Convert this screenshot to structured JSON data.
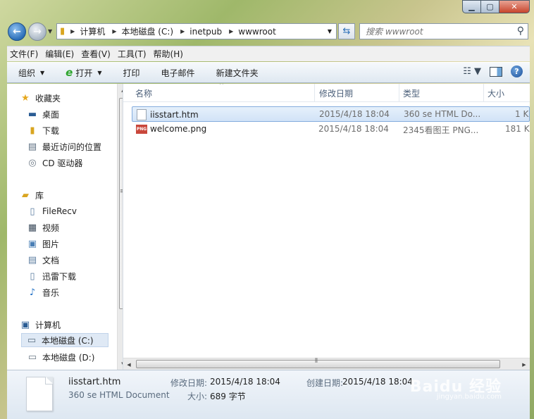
{
  "address": {
    "crumbs": [
      "计算机",
      "本地磁盘 (C:)",
      "inetpub",
      "wwwroot"
    ]
  },
  "search": {
    "placeholder": "搜索 wwwroot"
  },
  "menu": [
    "文件(F)",
    "编辑(E)",
    "查看(V)",
    "工具(T)",
    "帮助(H)"
  ],
  "toolbar": {
    "organize": "组织",
    "open": "打开",
    "print": "打印",
    "email": "电子邮件",
    "new_folder": "新建文件夹"
  },
  "nav": {
    "favorites": "收藏夹",
    "desktop": "桌面",
    "downloads": "下载",
    "recent": "最近访问的位置",
    "cd_drive": "CD 驱动器",
    "library": "库",
    "filerecv": "FileRecv",
    "video": "视频",
    "pictures": "图片",
    "documents": "文档",
    "xunlei": "迅雷下载",
    "music": "音乐",
    "computer": "计算机",
    "local_c": "本地磁盘 (C:)",
    "local_d": "本地磁盘 (D:)"
  },
  "columns": {
    "name": "名称",
    "modified": "修改日期",
    "type": "类型",
    "size": "大小"
  },
  "files": [
    {
      "name": "iisstart.htm",
      "modified": "2015/4/18 18:04",
      "type": "360 se HTML Do...",
      "size": "1 K"
    },
    {
      "name": "welcome.png",
      "modified": "2015/4/18 18:04",
      "type": "2345看图王 PNG...",
      "size": "181 K"
    }
  ],
  "details": {
    "filename": "iisstart.htm",
    "filetype": "360 se HTML Document",
    "modified_label": "修改日期:",
    "modified_value": "2015/4/18 18:04",
    "size_label": "大小:",
    "size_value": "689 字节",
    "created_label": "创建日期:",
    "created_value": "2015/4/18 18:04"
  },
  "watermark": {
    "main": "Baidu 经验",
    "sub": "jingyan.baidu.com"
  }
}
